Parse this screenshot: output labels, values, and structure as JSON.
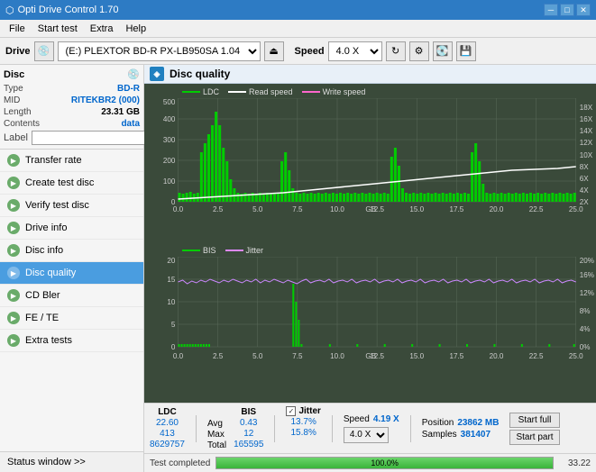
{
  "app": {
    "title": "Opti Drive Control 1.70",
    "icon": "⬡"
  },
  "titlebar": {
    "minimize": "─",
    "maximize": "□",
    "close": "✕"
  },
  "menu": {
    "items": [
      "File",
      "Start test",
      "Extra",
      "Help"
    ]
  },
  "drive_toolbar": {
    "drive_label": "Drive",
    "drive_value": "(E:) PLEXTOR BD-R  PX-LB950SA 1.04",
    "speed_label": "Speed",
    "speed_value": "4.0 X"
  },
  "disc": {
    "panel_title": "Disc",
    "type_label": "Type",
    "type_value": "BD-R",
    "mid_label": "MID",
    "mid_value": "RITEKBR2 (000)",
    "length_label": "Length",
    "length_value": "23.31 GB",
    "contents_label": "Contents",
    "contents_value": "data",
    "label_label": "Label",
    "label_value": ""
  },
  "nav": {
    "items": [
      {
        "id": "transfer-rate",
        "label": "Transfer rate",
        "active": false
      },
      {
        "id": "create-test-disc",
        "label": "Create test disc",
        "active": false
      },
      {
        "id": "verify-test-disc",
        "label": "Verify test disc",
        "active": false
      },
      {
        "id": "drive-info",
        "label": "Drive info",
        "active": false
      },
      {
        "id": "disc-info",
        "label": "Disc info",
        "active": false
      },
      {
        "id": "disc-quality",
        "label": "Disc quality",
        "active": true
      },
      {
        "id": "cd-bler",
        "label": "CD Bler",
        "active": false
      },
      {
        "id": "fe-te",
        "label": "FE / TE",
        "active": false
      },
      {
        "id": "extra-tests",
        "label": "Extra tests",
        "active": false
      }
    ],
    "status_window": "Status window >>"
  },
  "disc_quality": {
    "title": "Disc quality",
    "chart1": {
      "legend": [
        {
          "label": "LDC",
          "color": "#00cc00"
        },
        {
          "label": "Read speed",
          "color": "#ffffff"
        },
        {
          "label": "Write speed",
          "color": "#ff66cc"
        }
      ],
      "y_max": 500,
      "y_right_max": 18,
      "x_max": 25,
      "y_labels": [
        "0",
        "100",
        "200",
        "300",
        "400",
        "500"
      ],
      "y_right_labels": [
        "2X",
        "4X",
        "6X",
        "8X",
        "10X",
        "12X",
        "14X",
        "16X",
        "18X"
      ],
      "x_labels": [
        "0.0",
        "2.5",
        "5.0",
        "7.5",
        "10.0",
        "12.5",
        "15.0",
        "17.5",
        "20.0",
        "22.5",
        "25.0"
      ]
    },
    "chart2": {
      "legend": [
        {
          "label": "BIS",
          "color": "#00cc00"
        },
        {
          "label": "Jitter",
          "color": "#dd88ff"
        }
      ],
      "y_max": 20,
      "y_right_max": 20,
      "x_max": 25,
      "y_labels": [
        "0",
        "5",
        "10",
        "15",
        "20"
      ],
      "y_right_labels": [
        "0%",
        "4%",
        "8%",
        "12%",
        "16%",
        "20%"
      ],
      "x_labels": [
        "0.0",
        "2.5",
        "5.0",
        "7.5",
        "10.0",
        "12.5",
        "15.0",
        "17.5",
        "20.0",
        "22.5",
        "25.0"
      ]
    }
  },
  "stats": {
    "ldc_label": "LDC",
    "bis_label": "BIS",
    "jitter_label": "Jitter",
    "speed_label": "Speed",
    "avg_label": "Avg",
    "max_label": "Max",
    "total_label": "Total",
    "ldc_avg": "22.60",
    "ldc_max": "413",
    "ldc_total": "8629757",
    "bis_avg": "0.43",
    "bis_max": "12",
    "bis_total": "165595",
    "jitter_avg": "13.7%",
    "jitter_max": "15.8%",
    "speed_val": "4.19 X",
    "speed_select": "4.0 X",
    "position_label": "Position",
    "position_val": "23862 MB",
    "samples_label": "Samples",
    "samples_val": "381407",
    "start_full": "Start full",
    "start_part": "Start part"
  },
  "progress": {
    "status": "Test completed",
    "percent": 100,
    "percent_text": "100.0%",
    "time": "33.22"
  }
}
